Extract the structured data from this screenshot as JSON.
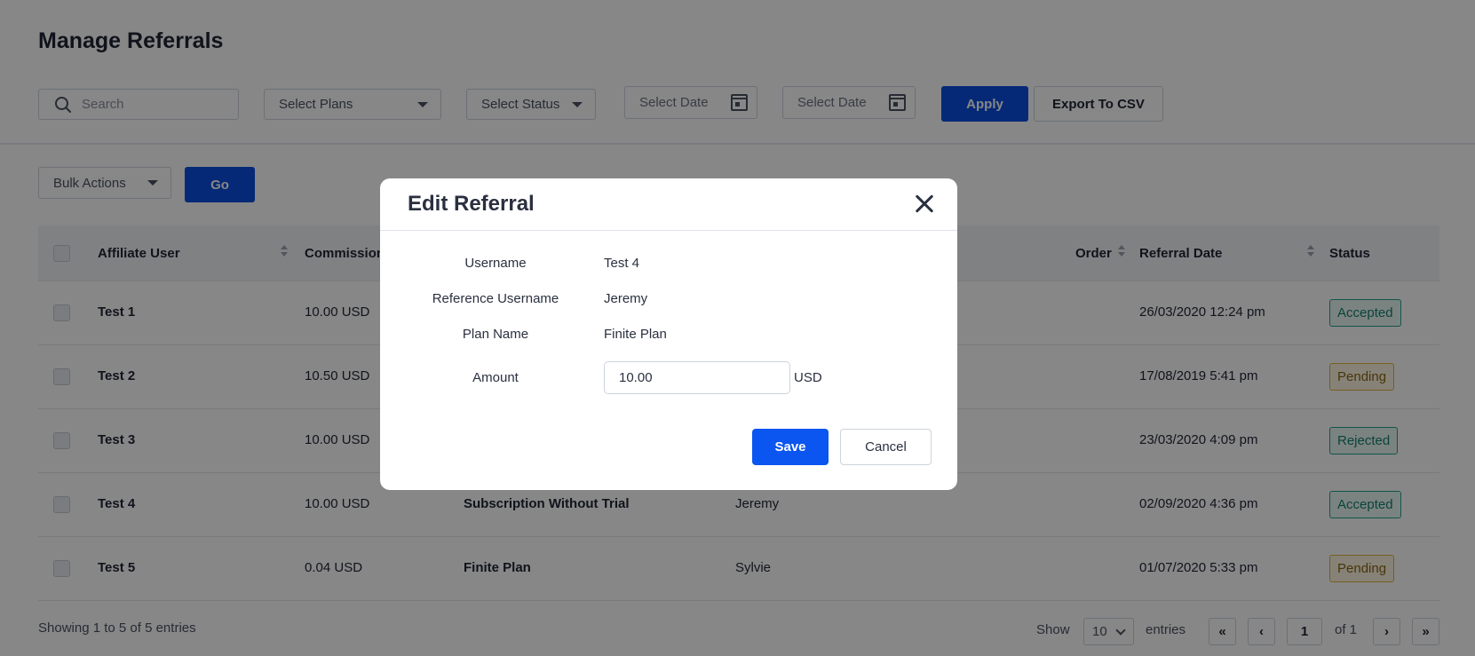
{
  "page": {
    "title": "Manage Referrals"
  },
  "filters": {
    "search_placeholder": "Search",
    "plans_label": "Select Plans",
    "status_label": "Select Status",
    "date_from_label": "Select Date",
    "date_to_label": "Select Date",
    "apply_label": "Apply",
    "export_label": "Export To CSV"
  },
  "bulk": {
    "label": "Bulk Actions",
    "go_label": "Go"
  },
  "table": {
    "columns": {
      "affiliate_user": "Affiliate User",
      "commission": "Commission",
      "order": "Order",
      "referral_date": "Referral Date",
      "status": "Status"
    },
    "rows": [
      {
        "user": "Test 1",
        "commission": "10.00 USD",
        "plan": "",
        "reference": "",
        "date": "26/03/2020 12:24 pm",
        "status": "Accepted"
      },
      {
        "user": "Test 2",
        "commission": "10.50 USD",
        "plan": "",
        "reference": "",
        "date": "17/08/2019 5:41 pm",
        "status": "Pending"
      },
      {
        "user": "Test 3",
        "commission": "10.00 USD",
        "plan": "",
        "reference": "",
        "date": "23/03/2020 4:09 pm",
        "status": "Rejected"
      },
      {
        "user": "Test 4",
        "commission": "10.00 USD",
        "plan": "Subscription Without Trial",
        "reference": "Jeremy",
        "date": "02/09/2020 4:36 pm",
        "status": "Accepted"
      },
      {
        "user": "Test 5",
        "commission": "0.04 USD",
        "plan": "Finite Plan",
        "reference": "Sylvie",
        "date": "01/07/2020 5:33 pm",
        "status": "Pending"
      }
    ]
  },
  "footer": {
    "summary": "Showing 1 to 5 of 5 entries",
    "show_label": "Show",
    "page_size": "10",
    "entries_label": "entries",
    "first": "«",
    "prev": "‹",
    "current_page": "1",
    "of_label": "of 1",
    "next": "›",
    "last": "»"
  },
  "modal": {
    "title": "Edit Referral",
    "fields": {
      "username_label": "Username",
      "username_value": "Test 4",
      "reference_label": "Reference Username",
      "reference_value": "Jeremy",
      "plan_label": "Plan Name",
      "plan_value": "Finite Plan",
      "amount_label": "Amount",
      "amount_value": "10.00",
      "amount_unit": "USD"
    },
    "save_label": "Save",
    "cancel_label": "Cancel"
  },
  "colors": {
    "primary": "#0b4fe0",
    "accepted": "#1fa38a",
    "pending": "#e3b23c",
    "overlay": "rgba(0,0,0,0.47)"
  },
  "icons": [
    "search-icon",
    "calendar-icon",
    "sort-icon",
    "close-icon",
    "chevron-down-icon"
  ]
}
